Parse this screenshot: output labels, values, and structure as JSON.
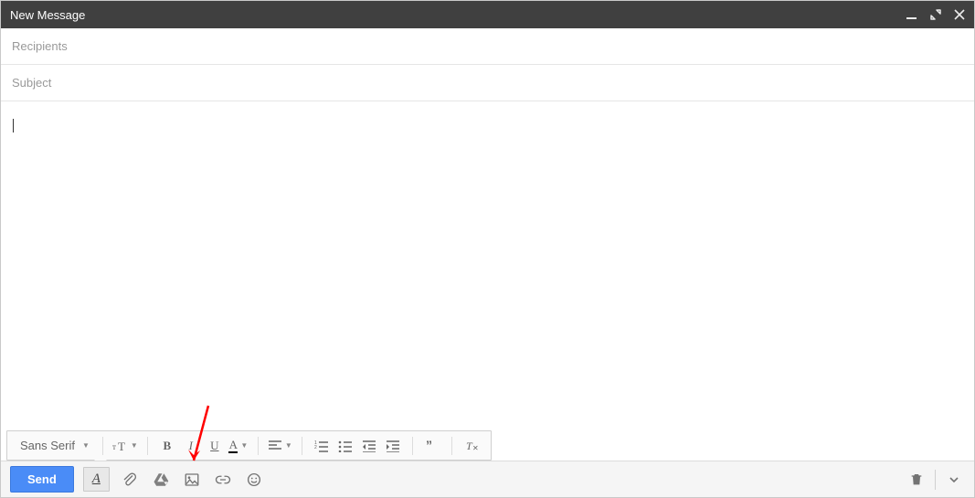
{
  "titlebar": {
    "title": "New Message"
  },
  "fields": {
    "recipients_placeholder": "Recipients",
    "recipients_value": "",
    "subject_placeholder": "Subject",
    "subject_value": ""
  },
  "editor": {
    "content": ""
  },
  "formatting": {
    "font_label": "Sans Serif"
  },
  "actions": {
    "send_label": "Send"
  },
  "annotation": {
    "note": "red arrow pointing at insert-photo icon"
  }
}
